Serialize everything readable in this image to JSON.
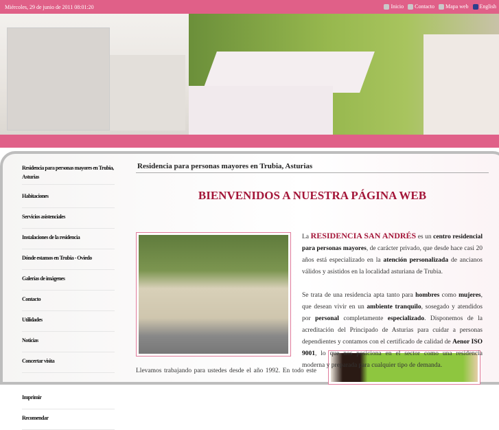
{
  "topbar": {
    "date": "Miércoles, 29 de junio de 2011 08:01:20",
    "links": [
      "Inicio",
      "Contacto",
      "Mapa web",
      "English"
    ]
  },
  "nav": [
    "Residencia para personas mayores en Trubia, Asturias",
    "Habitaciones",
    "Servicios asistenciales",
    "Instalaciones de la residencia",
    "Dónde estamos en Trubia - Oviedo",
    "Galerías de imágenes",
    "Contacto",
    "Utilidades",
    "Noticias",
    "Concertar visita",
    "Imprimir",
    "Recomendar"
  ],
  "main": {
    "subtitle": "Residencia para personas mayores en Trubia, Asturias",
    "welcome": "BIENVENIDOS A NUESTRA PÁGINA WEB",
    "p1": {
      "a": "La ",
      "name": "RESIDENCIA SAN ANDRÉS",
      "b": " es un ",
      "c": "centro residencial para personas mayores",
      "d": ", de carácter privado, que desde hace casi 20 años está especializado en la ",
      "e": "atención personalizada",
      "f": " de ancianos válidos y asistidos en la localidad asturiana de Trubia."
    },
    "p2": {
      "a": "Se trata de una residencia apta tanto para ",
      "b": "hombres",
      "c": " como ",
      "d": "mujeres",
      "e": ", que desean vivir en un ",
      "f": "ambiente tranquilo",
      "g": ", sosegado y atendidos por ",
      "h": "personal",
      "i": " completamente ",
      "j": "especializado",
      "k": ". Disponemos de la acreditación del Principado de Asturias para cuidar a personas dependientes y contamos con el certificado de calidad de ",
      "l": "Aenor ISO 9001",
      "m": ", lo que nos posiciona en el sector como una residencia moderna y preparada para cualquier tipo de demanda."
    },
    "p3": "Llevamos trabajando para ustedes desde el año 1992. En todo este"
  }
}
